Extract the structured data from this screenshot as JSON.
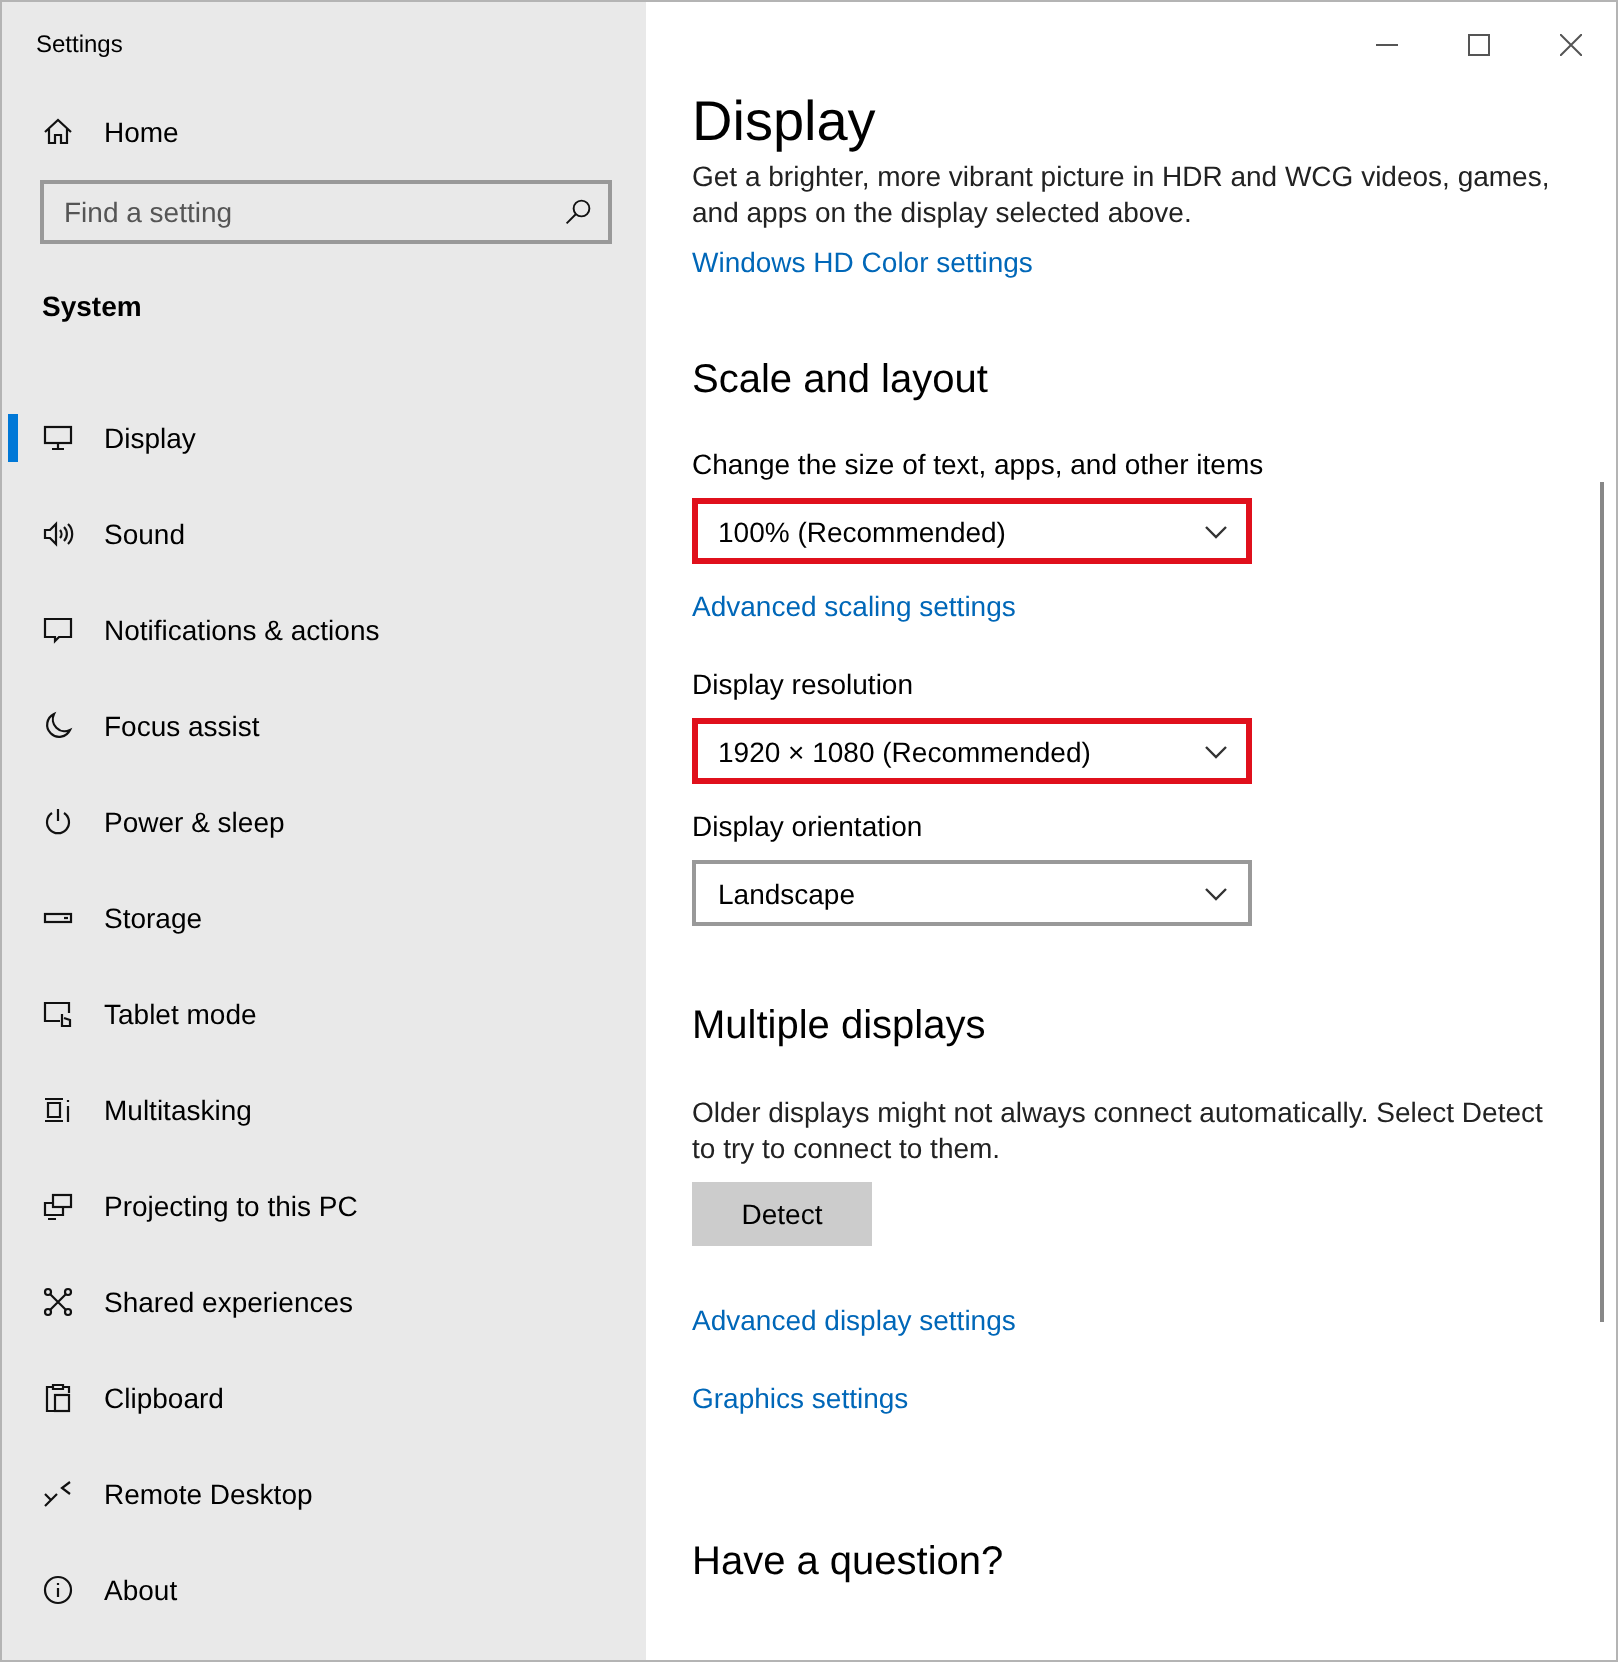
{
  "window": {
    "title": "Settings"
  },
  "sidebar": {
    "home": "Home",
    "search": {
      "placeholder": "Find a setting"
    },
    "section": "System",
    "items": [
      {
        "label": "Display",
        "kind": "display",
        "selected": true
      },
      {
        "label": "Sound",
        "kind": "sound",
        "selected": false
      },
      {
        "label": "Notifications & actions",
        "kind": "notifications",
        "selected": false
      },
      {
        "label": "Focus assist",
        "kind": "focus",
        "selected": false
      },
      {
        "label": "Power & sleep",
        "kind": "power",
        "selected": false
      },
      {
        "label": "Storage",
        "kind": "storage",
        "selected": false
      },
      {
        "label": "Tablet mode",
        "kind": "tablet",
        "selected": false
      },
      {
        "label": "Multitasking",
        "kind": "multitasking",
        "selected": false
      },
      {
        "label": "Projecting to this PC",
        "kind": "projecting",
        "selected": false
      },
      {
        "label": "Shared experiences",
        "kind": "shared",
        "selected": false
      },
      {
        "label": "Clipboard",
        "kind": "clipboard",
        "selected": false
      },
      {
        "label": "Remote Desktop",
        "kind": "remote",
        "selected": false
      },
      {
        "label": "About",
        "kind": "about",
        "selected": false
      }
    ]
  },
  "page": {
    "title": "Display",
    "content": [
      {
        "kind": "text",
        "text": "Get a brighter, more vibrant picture in HDR and WCG videos, games, and apps on the display selected above."
      },
      {
        "kind": "link",
        "text": "Windows HD Color settings"
      },
      {
        "kind": "heading",
        "text": "Scale and layout"
      },
      {
        "kind": "label",
        "text": "Change the size of text, apps, and other items"
      },
      {
        "kind": "dropdown",
        "value": "100% (Recommended)",
        "highlighted": true
      },
      {
        "kind": "link",
        "text": "Advanced scaling settings"
      },
      {
        "kind": "label",
        "text": "Display resolution"
      },
      {
        "kind": "dropdown",
        "value": "1920 × 1080 (Recommended)",
        "highlighted": true
      },
      {
        "kind": "label",
        "text": "Display orientation"
      },
      {
        "kind": "dropdown",
        "value": "Landscape",
        "highlighted": false
      },
      {
        "kind": "heading",
        "text": "Multiple displays"
      },
      {
        "kind": "text",
        "text": "Older displays might not always connect automatically. Select Detect to try to connect to them."
      },
      {
        "kind": "button",
        "text": "Detect"
      },
      {
        "kind": "link",
        "text": "Advanced display settings"
      },
      {
        "kind": "link",
        "text": "Graphics settings"
      },
      {
        "kind": "heading",
        "text": "Have a question?"
      }
    ]
  }
}
